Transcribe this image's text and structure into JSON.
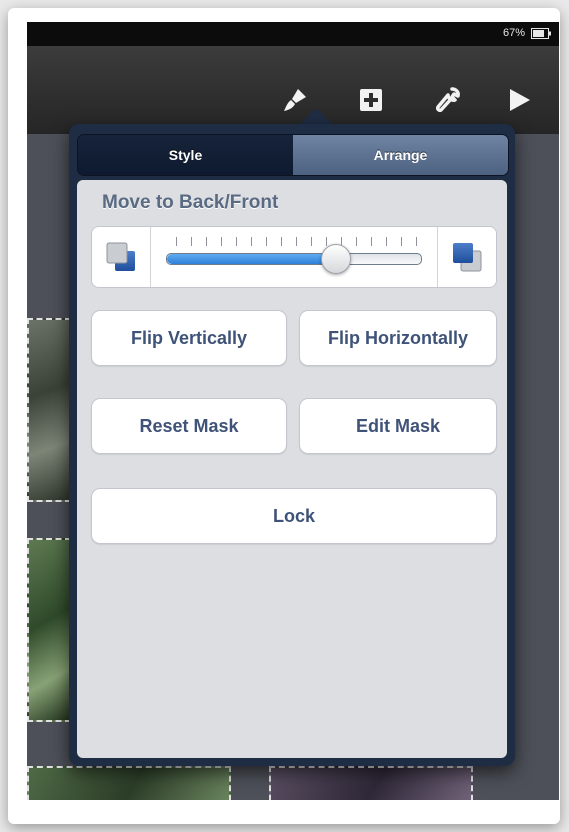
{
  "status_bar": {
    "battery_text": "67%",
    "battery_icon": "battery-icon"
  },
  "toolbar": {
    "icons": [
      "paintbrush-icon",
      "add-icon",
      "wrench-icon",
      "play-icon"
    ]
  },
  "popover": {
    "tabs": [
      {
        "label": "Style",
        "active": true
      },
      {
        "label": "Arrange",
        "active": false
      }
    ],
    "section_title": "Move to Back/Front",
    "layer_slider": {
      "position_fraction": 0.66,
      "back_icon": "send-to-back-icon",
      "front_icon": "bring-to-front-icon"
    },
    "buttons": {
      "flip_vertically": "Flip Vertically",
      "flip_horizontally": "Flip Horizontally",
      "reset_mask": "Reset Mask",
      "edit_mask": "Edit Mask",
      "lock": "Lock"
    }
  },
  "colors": {
    "accent_blue": "#2e7fd9",
    "button_text": "#3f5378",
    "popover_frame": "#1f2d44"
  }
}
